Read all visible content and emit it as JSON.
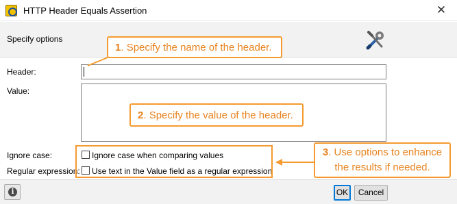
{
  "window": {
    "title": "HTTP Header Equals Assertion",
    "close_glyph": "✕"
  },
  "section": {
    "title": "Specify options",
    "icon": "tools-icon"
  },
  "fields": {
    "header_label": "Header:",
    "header_value": "",
    "value_label": "Value:",
    "value_value": ""
  },
  "options": {
    "ignore_case_label": "Ignore case:",
    "ignore_case_checkbox_label": "Ignore case when comparing values",
    "ignore_case_checked": false,
    "regex_label": "Regular expression:",
    "regex_checkbox_label": "Use text in the Value field as a regular expression",
    "regex_checked": false
  },
  "callouts": [
    {
      "num": "1",
      "text": "Specify the name of the header."
    },
    {
      "num": "2",
      "text": "Specify the value of the header."
    },
    {
      "num": "3",
      "text_line1": "Use options to enhance",
      "text_line2": "the results if needed."
    }
  ],
  "footer": {
    "info_glyph": "i",
    "ok_label": "OK",
    "cancel_label": "Cancel"
  },
  "colors": {
    "callout_orange": "#f59a2e",
    "callout_text": "#e8831f",
    "band": "#f2f2f2",
    "default_button_border": "#0078d7"
  }
}
